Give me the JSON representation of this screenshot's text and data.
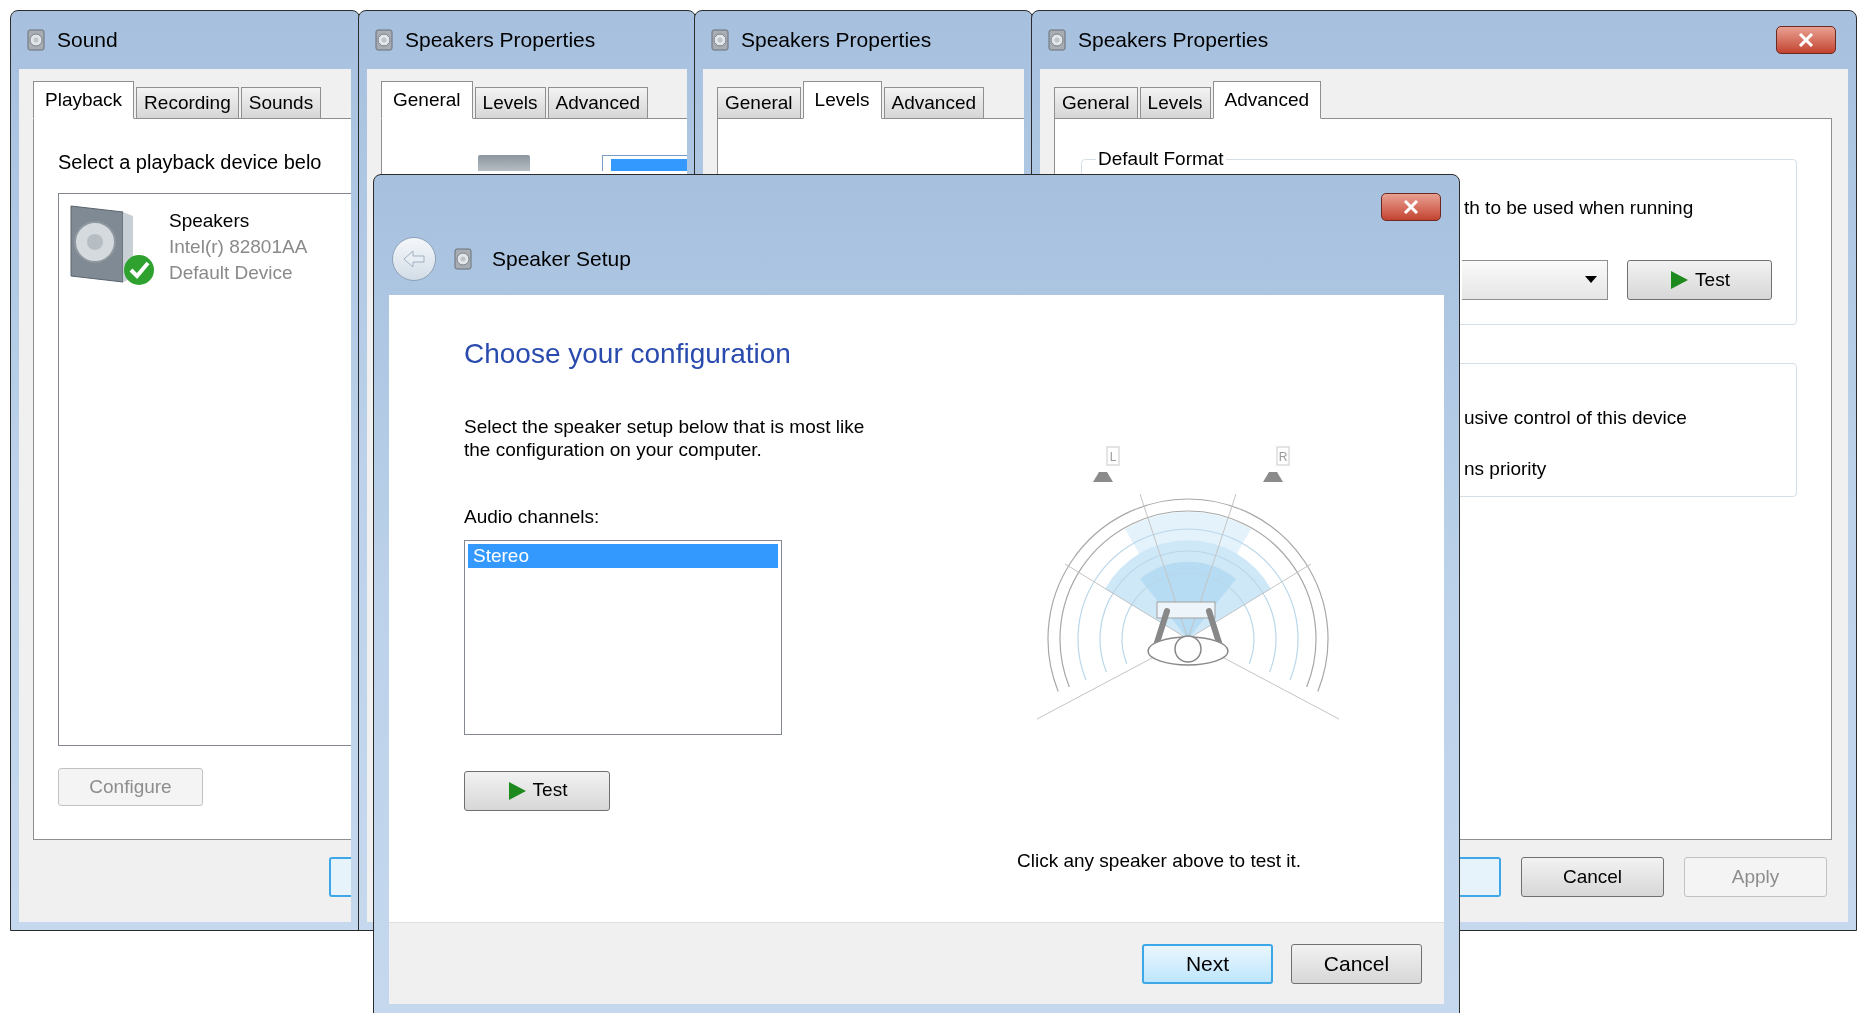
{
  "sound_window": {
    "title": "Sound",
    "tabs": [
      {
        "label": "Playback",
        "selected": true
      },
      {
        "label": "Recording",
        "selected": false
      },
      {
        "label": "Sounds",
        "selected": false
      }
    ],
    "instruction": "Select a playback device belo",
    "devices": [
      {
        "name": "Speakers",
        "driver": "Intel(r) 82801AA",
        "status": "Default Device",
        "is_default": true
      }
    ],
    "configure_button": {
      "label": "Configure",
      "disabled": true
    }
  },
  "properties_windows": [
    {
      "kind": "general",
      "title": "Speakers Properties",
      "tabs": [
        {
          "label": "General",
          "selected": true
        },
        {
          "label": "Levels",
          "selected": false
        },
        {
          "label": "Advanced",
          "selected": false
        }
      ]
    },
    {
      "kind": "levels",
      "title": "Speakers Properties",
      "tabs": [
        {
          "label": "General",
          "selected": false
        },
        {
          "label": "Levels",
          "selected": true
        },
        {
          "label": "Advanced",
          "selected": false
        }
      ]
    },
    {
      "kind": "advanced",
      "title": "Speakers Properties",
      "tabs": [
        {
          "label": "General",
          "selected": false
        },
        {
          "label": "Levels",
          "selected": false
        },
        {
          "label": "Advanced",
          "selected": true
        }
      ],
      "group_label": "Default Format",
      "description": "th to be used when running",
      "test_button": "Test",
      "exclusive_text": "usive control of this device",
      "priority_text": "ns priority",
      "buttons": [
        {
          "label": "Cancel",
          "disabled": false
        },
        {
          "label": "Apply",
          "disabled": true
        }
      ]
    }
  ],
  "speaker_setup": {
    "title": "Speaker Setup",
    "heading": "Choose your configuration",
    "description": "Select the speaker setup below that is most like\nthe configuration on your computer.",
    "channels_label": "Audio channels:",
    "channels": [
      {
        "label": "Stereo",
        "selected": true
      }
    ],
    "test_button": "Test",
    "speaker_labels": [
      "L",
      "R"
    ],
    "hint": "Click any speaker above to test it.",
    "buttons": [
      {
        "label": "Next",
        "default": true
      },
      {
        "label": "Cancel",
        "default": false
      }
    ]
  }
}
